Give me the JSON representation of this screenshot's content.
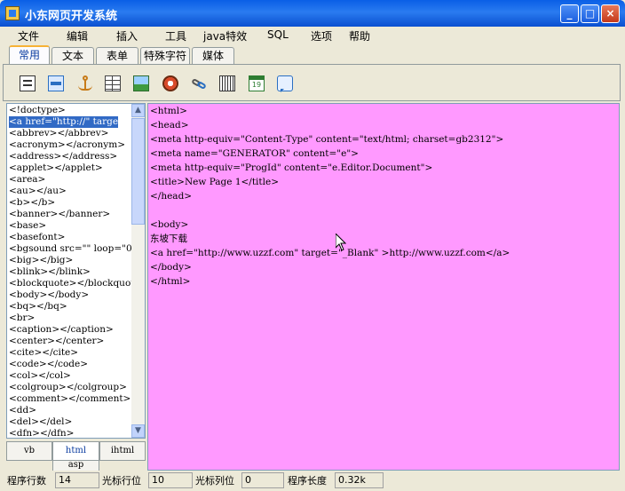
{
  "window": {
    "title": "小东网页开发系统",
    "buttons": {
      "minimize": "_",
      "maximize": "□",
      "close": "×"
    }
  },
  "menu": [
    "文件",
    "编辑",
    "插入",
    "工具",
    "java特效",
    "SQL",
    "选项",
    "帮助"
  ],
  "tabs": [
    "常用",
    "文本",
    "表单",
    "特殊字符",
    "媒体"
  ],
  "toolbar_icons": [
    "new-doc-icon",
    "frame-icon",
    "anchor-icon",
    "table-icon",
    "image-icon",
    "media-icon",
    "link-icon",
    "keyboard-icon",
    "calendar-icon",
    "comment-icon"
  ],
  "calendar_day": "19",
  "tag_list": [
    "<!doctype>",
    "<a href=\"http://\" targe",
    "<abbrev></abbrev>",
    "<acronym></acronym>",
    "<address></address>",
    "<applet></applet>",
    "<area>",
    "<au></au>",
    "<b></b>",
    "<banner></banner>",
    "<base>",
    "<basefont>",
    "<bgsound src=\"\" loop=\"0",
    "<big></big>",
    "<blink></blink>",
    "<blockquote></blockquot",
    "<body></body>",
    "<bq></bq>",
    "<br>",
    "<caption></caption>",
    "<center></center>",
    "<cite></cite>",
    "<code></code>",
    "<col></col>",
    "<colgroup></colgroup>",
    "<comment></comment>",
    "<dd>",
    "<del></del>",
    "<dfn></dfn>"
  ],
  "selected_tag_index": 1,
  "bottom_tabs": [
    "vb",
    "html",
    "ihtml",
    "asp"
  ],
  "editor_lines": [
    "<html>",
    "<head>",
    "<meta http-equiv=\"Content-Type\" content=\"text/html; charset=gb2312\">",
    "<meta name=\"GENERATOR\" content=\"e\">",
    "<meta http-equiv=\"ProgId\" content=\"e.Editor.Document\">",
    "<title>New Page 1</title>",
    "</head>",
    "",
    "<body>",
    "东坡下载",
    "<a href=\"http://www.uzzf.com\" target=\"_Blank\" >http://www.uzzf.com</a>",
    "</body>",
    "</html>"
  ],
  "editor_bg": "#ff99ff",
  "status": {
    "total_rows_label": "程序行数",
    "total_rows": "14",
    "cursor_row_label": "光标行位",
    "cursor_row": "10",
    "cursor_col_label": "光标列位",
    "cursor_col": "0",
    "length_label": "程序长度",
    "length": "0.32k"
  }
}
